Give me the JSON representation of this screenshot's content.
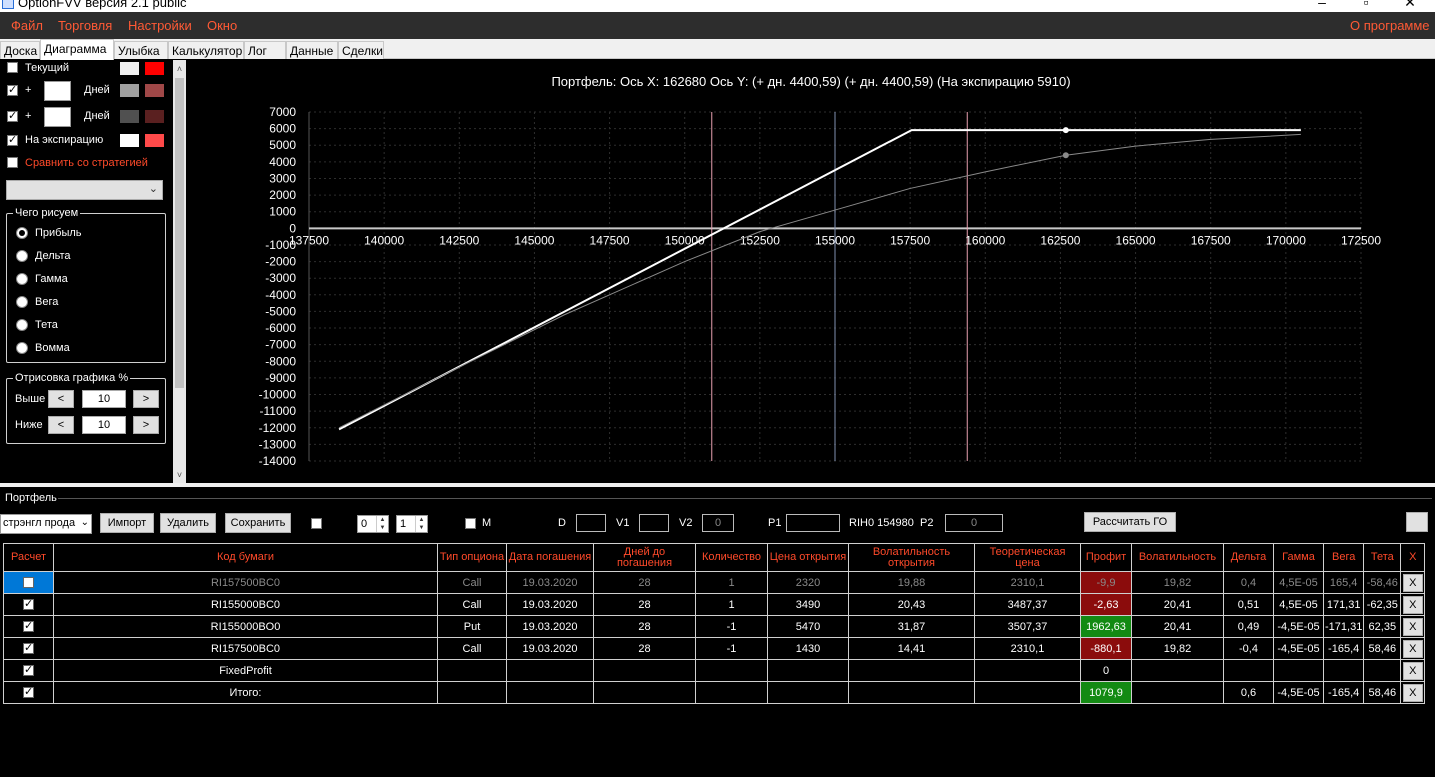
{
  "window": {
    "title": "OptionFVV версия 2.1 public"
  },
  "menu": {
    "items": [
      "Файл",
      "Торговля",
      "Настройки",
      "Окно"
    ],
    "about": "О программе"
  },
  "tabs": [
    "Доска",
    "Диаграмма",
    "Улыбка",
    "Калькулятор",
    "Лог",
    "Данные",
    "Сделки"
  ],
  "active_tab": "Диаграмма",
  "left_panel": {
    "current_label": "Текущий",
    "plus": "+",
    "days_label": "Дней",
    "expiration_label": "На экспирацию",
    "compare_label": "Сравнить со стратегией",
    "what_group": "Чего рисуем",
    "radio_options": [
      "Прибыль",
      "Дельта",
      "Гамма",
      "Вега",
      "Тета",
      "Вомма"
    ],
    "selected_option": "Прибыль",
    "render_group": "Отрисовка графика %",
    "above_label": "Выше",
    "below_label": "Ниже",
    "above_value": "10",
    "below_value": "10",
    "step_left": "<",
    "step_right": ">",
    "colors": {
      "current": "#ff0000",
      "days1": "#a0a0a0",
      "days1_b": "#a04848",
      "days2": "#505050",
      "days2_b": "#5a2020",
      "expiration": "#ff4a4a"
    }
  },
  "chart_data": {
    "type": "line",
    "title": "Портфель: Ось X: 162680 Ось Y:  (+ дн. 4400,59)  (+ дн. 4400,59)  (На экспирацию 5910)",
    "xlim": [
      137500,
      172500
    ],
    "ylim": [
      -14000,
      7000
    ],
    "x_ticks": [
      137500,
      140000,
      142500,
      145000,
      147500,
      150000,
      152500,
      155000,
      157500,
      160000,
      162500,
      165000,
      167500,
      170000,
      172500
    ],
    "y_ticks": [
      7000,
      6000,
      5000,
      4000,
      3000,
      2000,
      1000,
      0,
      -1000,
      -2000,
      -3000,
      -4000,
      -5000,
      -6000,
      -7000,
      -8000,
      -9000,
      -10000,
      -11000,
      -12000,
      -13000,
      -14000
    ],
    "vertical_lines": [
      {
        "x": 150900,
        "color": "#e8a0b0"
      },
      {
        "x": 155000,
        "color": "#8090b0"
      },
      {
        "x": 159400,
        "color": "#e8a0b0"
      }
    ],
    "series": [
      {
        "color": "#ffffff",
        "x": [
          138500,
          157550,
          170500
        ],
        "y": [
          -12100,
          5910,
          5910
        ]
      },
      {
        "color": "#8a8a8a",
        "x": [
          138500,
          142000,
          146000,
          150000,
          152500,
          155000,
          157500,
          160000,
          162680,
          165000,
          167500,
          170500
        ],
        "y": [
          -12000,
          -8800,
          -5200,
          -2000,
          -200,
          1100,
          2400,
          3400,
          4400,
          4950,
          5350,
          5650
        ]
      }
    ],
    "markers": [
      {
        "x": 162680,
        "y": 5910,
        "color": "#ffffff"
      },
      {
        "x": 162680,
        "y": 4400,
        "color": "#8a8a8a"
      }
    ]
  },
  "portfolio": {
    "title": "Портфель",
    "strategy_combo": "стрэнгл прода",
    "buttons": {
      "import": "Импорт",
      "delete": "Удалить",
      "save": "Сохранить",
      "calc_go": "Рассчитать ГО"
    },
    "spin1": "0",
    "spin2": "1",
    "m_label": "M",
    "d_label": "D",
    "v1_label": "V1",
    "v2_label": "V2",
    "v2_value": "0",
    "p1_label": "P1",
    "rih_label": "RIH0 154980",
    "p2_label": "P2",
    "p2_value": "0",
    "columns": [
      "Расчет",
      "Код бумаги",
      "Тип опциона",
      "Дата погашения",
      "Дней до погашения",
      "Количество",
      "Цена открытия",
      "Волатильность открытия",
      "Теоретическая цена",
      "Профит",
      "Волатильность",
      "Дельта",
      "Гамма",
      "Вега",
      "Тета",
      "X"
    ],
    "rows": [
      {
        "code": "RI157500BC0",
        "type": "Call",
        "date": "19.03.2020",
        "days": "28",
        "qty": "1",
        "price": "2320",
        "vol_open": "19,88",
        "theo": "2310,1",
        "profit": "-9,9",
        "vol": "19,82",
        "delta": "0,4",
        "gamma": "4,5E-05",
        "vega": "165,4",
        "theta": "-58,46",
        "x": "X"
      },
      {
        "code": "RI155000BC0",
        "type": "Call",
        "date": "19.03.2020",
        "days": "28",
        "qty": "1",
        "price": "3490",
        "vol_open": "20,43",
        "theo": "3487,37",
        "profit": "-2,63",
        "vol": "20,41",
        "delta": "0,51",
        "gamma": "4,5E-05",
        "vega": "171,31",
        "theta": "-62,35",
        "x": "X"
      },
      {
        "code": "RI155000BO0",
        "type": "Put",
        "date": "19.03.2020",
        "days": "28",
        "qty": "-1",
        "price": "5470",
        "vol_open": "31,87",
        "theo": "3507,37",
        "profit": "1962,63",
        "vol": "20,41",
        "delta": "0,49",
        "gamma": "-4,5E-05",
        "vega": "-171,31",
        "theta": "62,35",
        "x": "X"
      },
      {
        "code": "RI157500BC0",
        "type": "Call",
        "date": "19.03.2020",
        "days": "28",
        "qty": "-1",
        "price": "1430",
        "vol_open": "14,41",
        "theo": "2310,1",
        "profit": "-880,1",
        "vol": "19,82",
        "delta": "-0,4",
        "gamma": "-4,5E-05",
        "vega": "-165,4",
        "theta": "58,46",
        "x": "X"
      },
      {
        "code": "FixedProfit",
        "type": "",
        "date": "",
        "days": "",
        "qty": "",
        "price": "",
        "vol_open": "",
        "theo": "",
        "profit": "0",
        "vol": "",
        "delta": "",
        "gamma": "",
        "vega": "",
        "theta": "",
        "x": "X"
      },
      {
        "code": "Итого:",
        "type": "",
        "date": "",
        "days": "",
        "qty": "",
        "price": "",
        "vol_open": "",
        "theo": "",
        "profit": "1079,9",
        "vol": "",
        "delta": "0,6",
        "gamma": "-4,5E-05",
        "vega": "-165,4",
        "theta": "58,46",
        "x": "X"
      }
    ]
  }
}
